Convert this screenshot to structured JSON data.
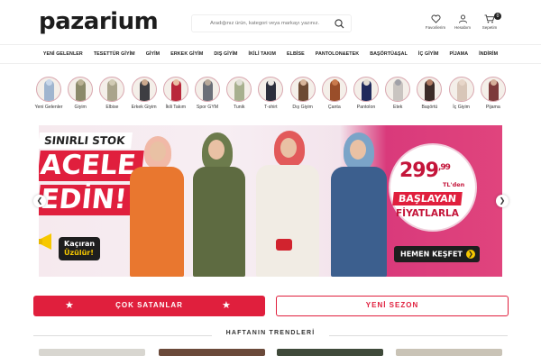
{
  "header": {
    "logo": "pazarium",
    "search_placeholder": "Aradığınız ürün, kategori veya markayı yazınız.",
    "favorites": "Favorilerim",
    "account": "Hesabım",
    "cart": "Sepetim",
    "cart_count": "0"
  },
  "nav": [
    "YENİ GELENLER",
    "TESETTÜR GİYİM",
    "GİYİM",
    "ERKEK GİYİM",
    "DIŞ GİYİM",
    "İKİLİ TAKIM",
    "ELBİSE",
    "PANTOLON&ETEK",
    "BAŞÖRTÜ&ŞAL",
    "İÇ GİYİM",
    "PİJAMA",
    "İNDİRİM"
  ],
  "categories": [
    {
      "label": "Yeni Gelenler",
      "color": "#9fb5cf",
      "head": "#c9d8ea"
    },
    {
      "label": "Giyim",
      "color": "#8b8a6a",
      "head": "#b9b193"
    },
    {
      "label": "Elbise",
      "color": "#a9a48b",
      "head": "#d1cbb4"
    },
    {
      "label": "Erkek Giyim",
      "color": "#3e3e42",
      "head": "#caa88d"
    },
    {
      "label": "İkili Takım",
      "color": "#b9283a",
      "head": "#e9c1a4"
    },
    {
      "label": "Spor GYM",
      "color": "#6b6f78",
      "head": "#b8a99a"
    },
    {
      "label": "Tunik",
      "color": "#a7b08e",
      "head": "#e0e0d6"
    },
    {
      "label": "T-shirt",
      "color": "#2c2f3c",
      "head": "#ece8e2"
    },
    {
      "label": "Dış Giyim",
      "color": "#6d4a33",
      "head": "#d8b59a"
    },
    {
      "label": "Çanta",
      "color": "#9a4e2a",
      "head": "#c97a4d"
    },
    {
      "label": "Pantolon",
      "color": "#1f2a5c",
      "head": "#e3ddd3"
    },
    {
      "label": "Etek",
      "color": "#c9c4c0",
      "head": "#a1a1a8"
    },
    {
      "label": "Başörtü",
      "color": "#3c2c28",
      "head": "#b07b62"
    },
    {
      "label": "İç Giyim",
      "color": "#d8c6b8",
      "head": "#e7d6c9"
    },
    {
      "label": "Pijama",
      "color": "#7d3b3b",
      "head": "#d5b09a"
    }
  ],
  "hero": {
    "stock": "SINIRLI STOK",
    "line1": "ACELE",
    "line2": "EDİN!",
    "kacir1": "Kaçıran",
    "kacir2": "Üzülür!",
    "price_main": "299",
    "price_dec": ",99",
    "currency": "TL'den",
    "baslayan": "BAŞLAYAN",
    "fiyat": "FİYATLARLA",
    "cta": "HEMEN KEŞFET",
    "cta_arrow": "❯"
  },
  "arrows": {
    "prev": "❮",
    "next": "❯"
  },
  "tabs": {
    "best": "ÇOK SATANLAR",
    "new": "YENİ SEZON",
    "star": "★"
  },
  "trends": {
    "title": "HAFTANIN TRENDLERİ"
  },
  "colors": {
    "accent": "#e01f3d",
    "dark": "#1e1e1e",
    "yellow": "#f7c800",
    "pink": "#d93a7b"
  }
}
